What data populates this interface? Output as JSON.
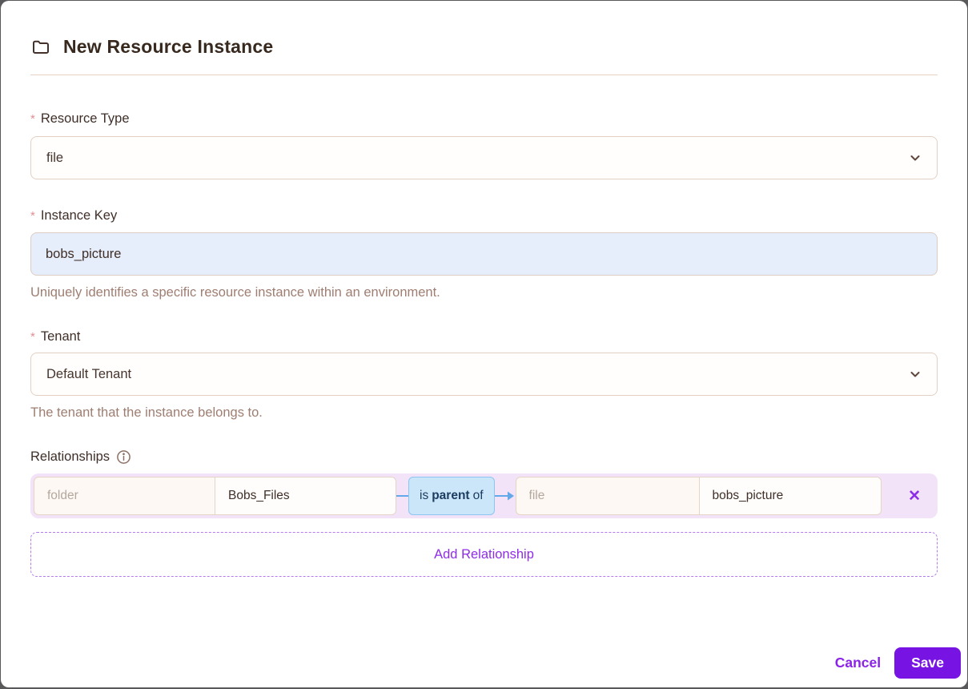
{
  "header": {
    "title": "New Resource Instance"
  },
  "required_marker": "*",
  "fields": {
    "resource_type": {
      "label": "Resource Type",
      "value": "file"
    },
    "instance_key": {
      "label": "Instance Key",
      "value": "bobs_picture",
      "help": "Uniquely identifies a specific resource instance within an environment."
    },
    "tenant": {
      "label": "Tenant",
      "value": "Default Tenant",
      "help": "The tenant that the instance belongs to."
    }
  },
  "relationships": {
    "label": "Relationships",
    "row": {
      "subject_type_placeholder": "folder",
      "subject_key_value": "Bobs_Files",
      "relation_prefix": "is",
      "relation": "parent",
      "relation_suffix": "of",
      "object_type_placeholder": "file",
      "object_key_value": "bobs_picture",
      "remove_glyph": "✕"
    },
    "add_label": "Add Relationship"
  },
  "footer": {
    "cancel_label": "Cancel",
    "save_label": "Save"
  },
  "icons": {
    "title": "folder-icon",
    "relationships_hint": "info-icon",
    "selects": "chevron-down-icon",
    "relation_link": "arrow-right-icon",
    "remove_row": "close-icon"
  },
  "colors": {
    "accent_purple": "#8a22e8",
    "save_button_purple": "#7714e3",
    "relation_badge_blue_bg": "#cbe6f9",
    "relation_badge_blue_border": "#8cc6f2",
    "relation_badge_text": "#1c3c60",
    "connector_blue": "#63a9e9",
    "row_background_lilac": "#f3e3f8",
    "instance_key_bg": "#e7eefb",
    "field_border_tan": "#e3d0c4",
    "title_text": "#38291f",
    "helper_text": "#9f7e72",
    "required_red": "#e18f92"
  }
}
